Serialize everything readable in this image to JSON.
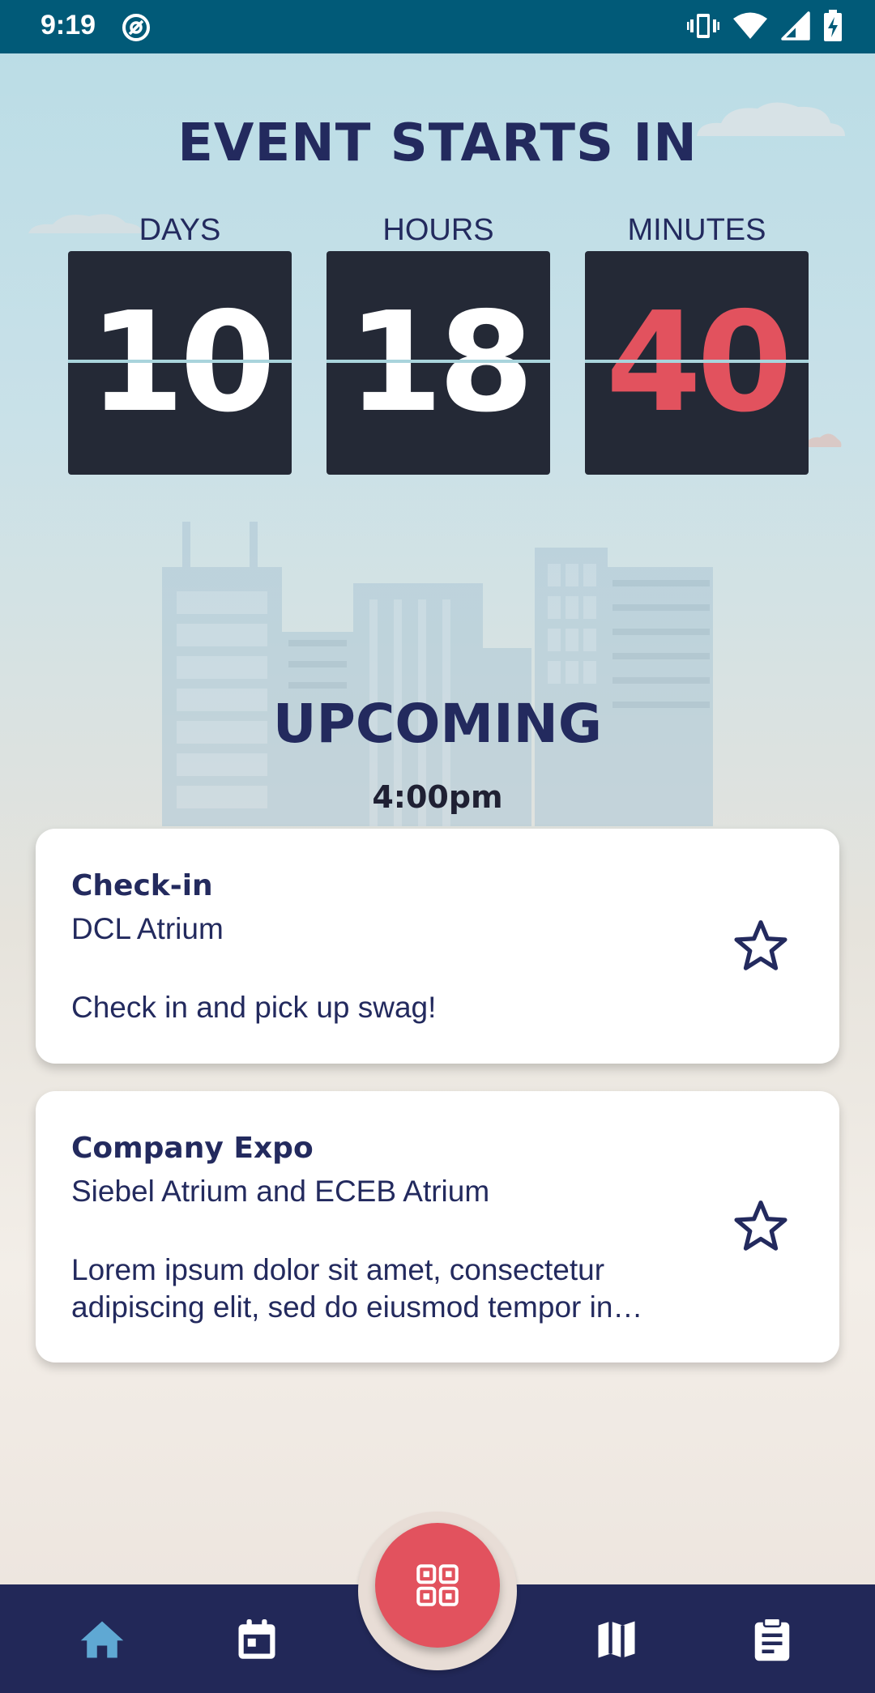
{
  "status_bar": {
    "time": "9:19",
    "icons": [
      "app-notification-icon",
      "vibrate-icon",
      "wifi-icon",
      "signal-icon",
      "battery-charging-icon"
    ]
  },
  "countdown": {
    "title": "EVENT STARTS IN",
    "units": [
      {
        "label": "DAYS",
        "value": "10"
      },
      {
        "label": "HOURS",
        "value": "18"
      },
      {
        "label": "MINUTES",
        "value": "40"
      }
    ],
    "accent_color": "#e2525e"
  },
  "upcoming": {
    "title": "UPCOMING",
    "time": "4:00pm",
    "events": [
      {
        "title": "Check-in",
        "location": "DCL Atrium",
        "description": "Check in and pick up swag!",
        "starred": false
      },
      {
        "title": "Company Expo",
        "location": "Siebel Atrium and ECEB Atrium",
        "description": "Lorem ipsum dolor sit amet, consectetur adipiscing elit, sed do eiusmod tempor in…",
        "starred": false
      }
    ]
  },
  "bottom_nav": {
    "items": [
      "home-icon",
      "calendar-icon",
      "map-icon",
      "clipboard-icon"
    ],
    "active": "home-icon",
    "fab_icon": "qr-code-icon",
    "active_color": "#5fa8d3",
    "bar_color": "#222858"
  }
}
